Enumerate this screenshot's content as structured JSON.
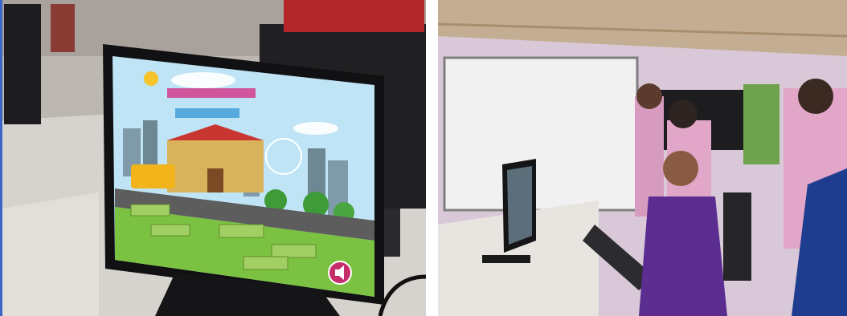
{
  "photos": [
    {
      "id_name": "left-photo",
      "subject": "monitor-showing-game",
      "screen_game": {
        "title_line_1": "",
        "title_line_2": "",
        "menu_buttons": [
          "",
          "",
          "",
          "",
          "",
          ""
        ]
      }
    },
    {
      "id_name": "right-photo",
      "subject": "teachers-at-computer"
    }
  ],
  "colors": {
    "frame_accent": "#3a66c8",
    "screen_sky": "#bfe4f5",
    "game_grass": "#7cc242",
    "menu_button": "#a2cf63",
    "school_red": "#c8372f",
    "bus_yellow": "#f2b31b",
    "shirt_purple": "#5b2d91",
    "shirt_pink": "#e2a6c8",
    "wall_lilac": "#d9c9d8"
  }
}
